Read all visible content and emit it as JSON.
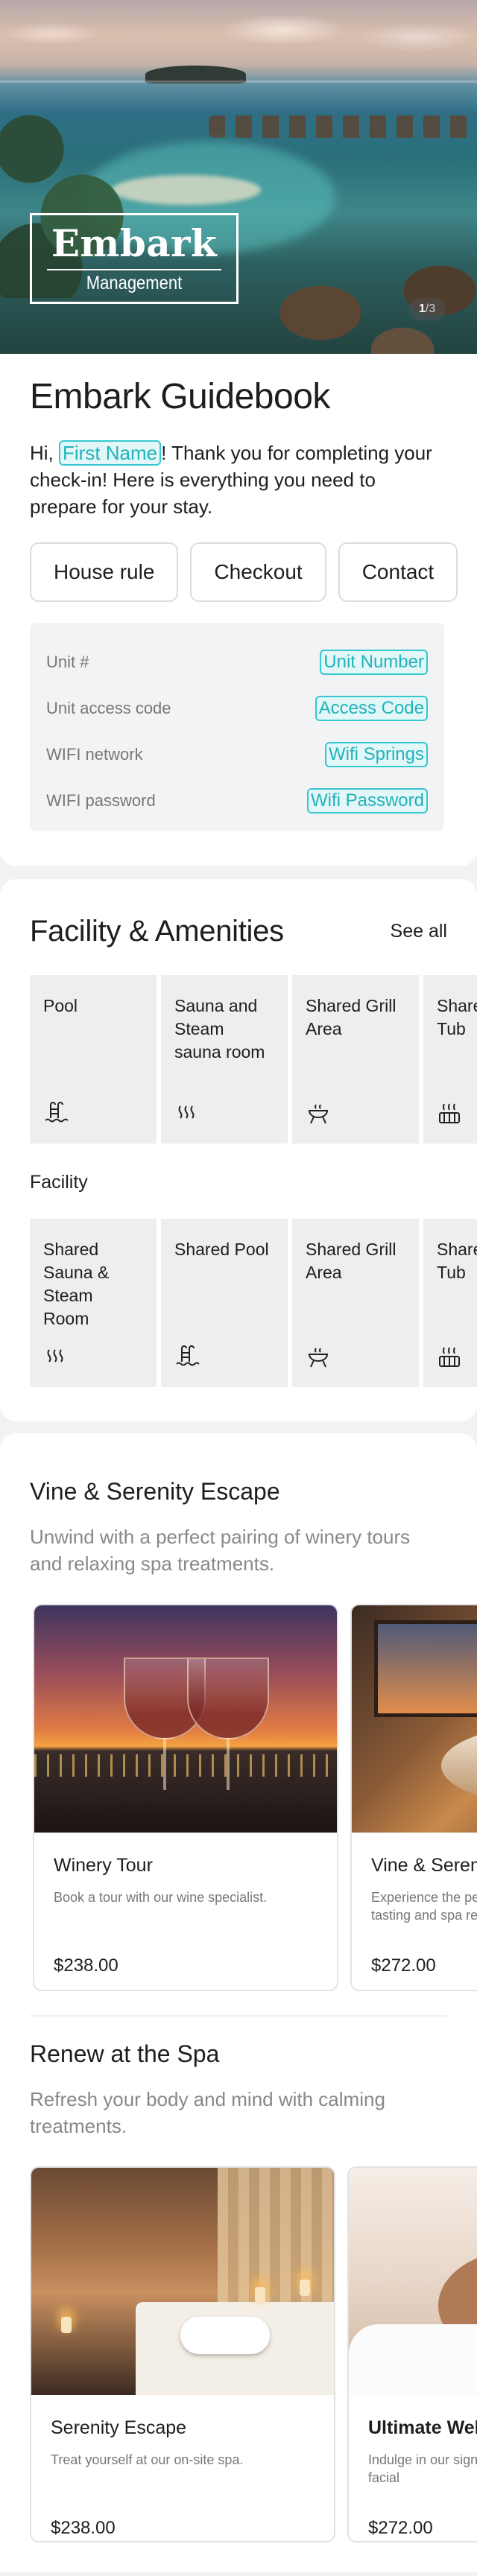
{
  "hero": {
    "logo_title": "Embark",
    "logo_subtitle": "Management",
    "pager_current": "1",
    "pager_rest": "/3"
  },
  "guide": {
    "title": "Embark Guidebook",
    "greeting_prefix": "Hi, ",
    "greeting_tag": "First Name",
    "greeting_suffix": "! Thank you for completing your check-in! Here is everything you need to prepare for your stay.",
    "pills": [
      "House rule",
      "Checkout",
      "Contact"
    ],
    "info": [
      {
        "label": "Unit #",
        "value": "Unit Number"
      },
      {
        "label": "Unit access code",
        "value": "Access Code"
      },
      {
        "label": "WIFI network",
        "value": "Wifi Springs"
      },
      {
        "label": "WIFI password",
        "value": "Wifi Password"
      }
    ]
  },
  "amenities": {
    "title": "Facility & Amenities",
    "see_all": "See all",
    "row1": [
      {
        "label": "Pool",
        "icon": "pool-icon"
      },
      {
        "label": "Sauna and Steam sauna room",
        "icon": "steam-icon"
      },
      {
        "label": "Shared Grill Area",
        "icon": "grill-icon"
      },
      {
        "label": "Shared Hot Tub",
        "icon": "hot-tub-icon"
      }
    ],
    "facility_label": "Facility",
    "row2": [
      {
        "label": "Shared Sauna & Steam Room",
        "icon": "steam-icon"
      },
      {
        "label": "Shared Pool",
        "icon": "pool-icon"
      },
      {
        "label": "Shared Grill Area",
        "icon": "grill-icon"
      },
      {
        "label": "Shared Hot Tub",
        "icon": "hot-tub-icon"
      }
    ]
  },
  "experiences": [
    {
      "title": "Vine & Serenity Escape",
      "description": "Unwind with a perfect pairing of winery tours and relaxing spa treatments.",
      "products": [
        {
          "title": "Winery Tour",
          "desc": "Book a tour with our wine specialist.",
          "price": "$238.00",
          "image": "wine-glasses"
        },
        {
          "title": "Vine & Serenity Escape",
          "desc": "Experience the perfect blend of wine tasting and spa relaxation for",
          "price": "$272.00",
          "image": "spa-tub"
        }
      ]
    },
    {
      "title": "Renew at the Spa",
      "description": "Refresh your body and mind with calming treatments.",
      "products": [
        {
          "title": "Serenity Escape",
          "desc": "Treat yourself at our on-site spa.",
          "price": "$238.00",
          "image": "spa-room"
        },
        {
          "title": "Ultimate Wellness",
          "desc": "Indulge in our signature massage and facial",
          "price": "$272.00",
          "image": "facial"
        }
      ]
    }
  ],
  "colors": {
    "accent": "#35c8cf",
    "tag_fill": "#e3f7f8",
    "tile_bg": "#eeeeee",
    "page_bg": "#f2f2f2"
  }
}
